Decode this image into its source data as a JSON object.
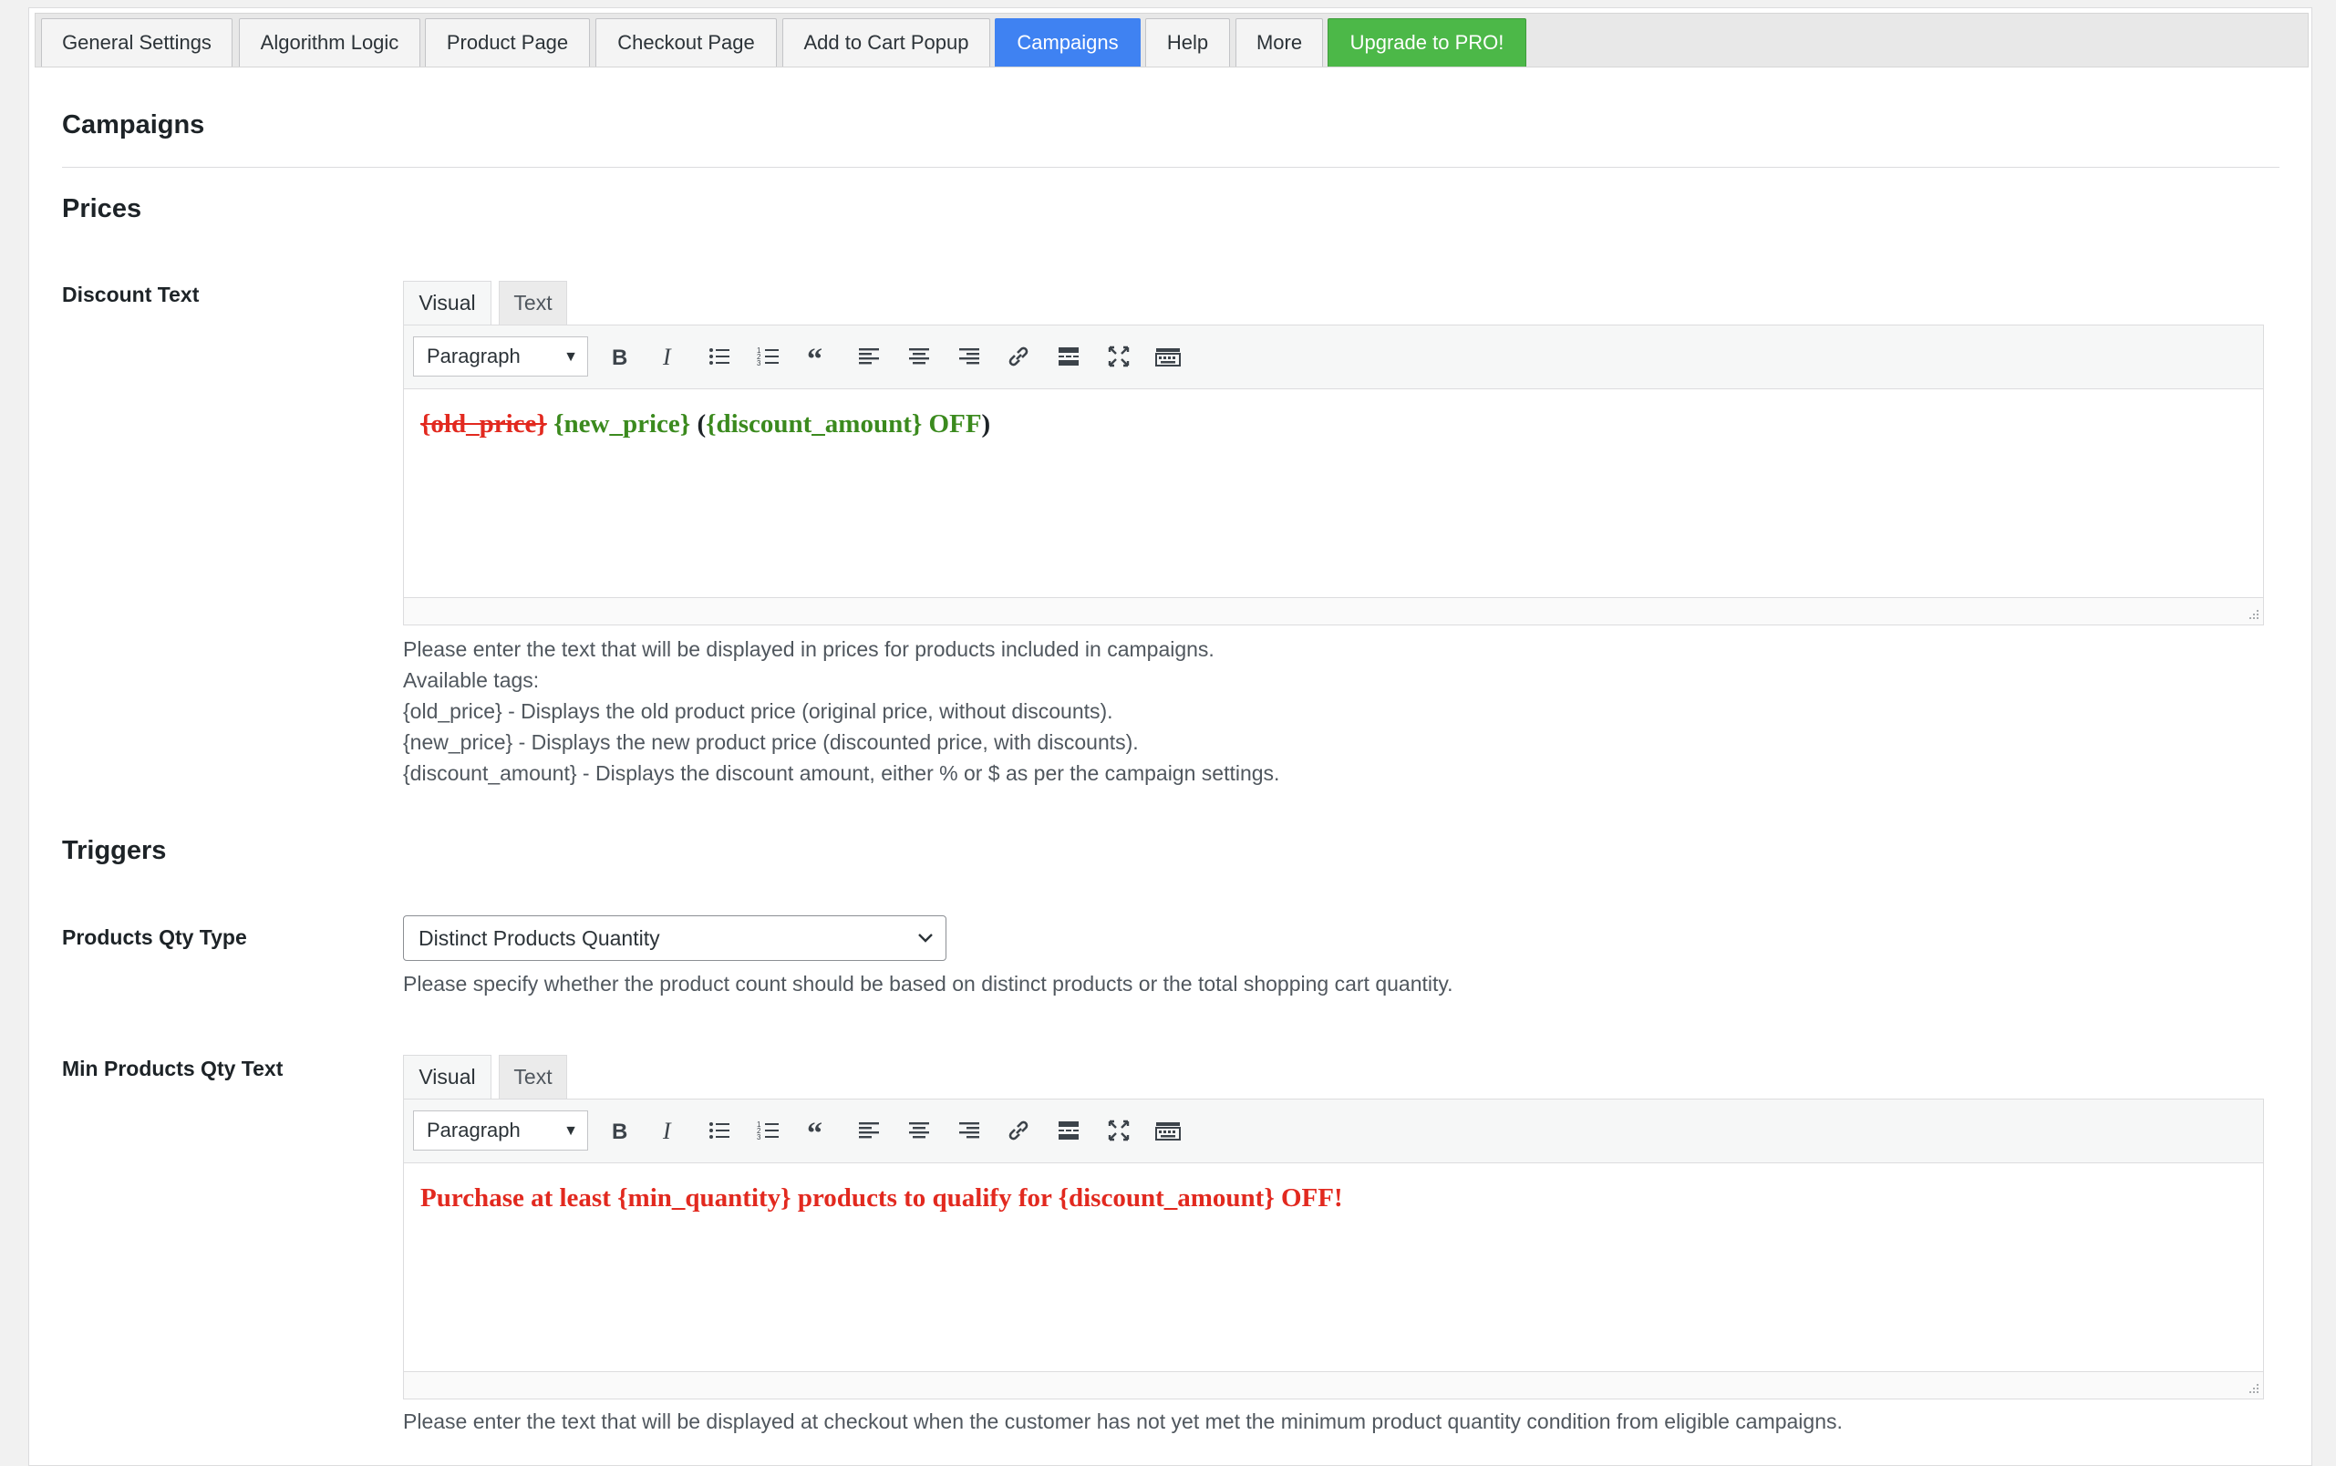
{
  "tabs": [
    {
      "label": "General Settings"
    },
    {
      "label": "Algorithm Logic"
    },
    {
      "label": "Product Page"
    },
    {
      "label": "Checkout Page"
    },
    {
      "label": "Add to Cart Popup"
    },
    {
      "label": "Campaigns",
      "active": true
    },
    {
      "label": "Help"
    },
    {
      "label": "More"
    },
    {
      "label": "Upgrade to PRO!"
    }
  ],
  "page": {
    "title": "Campaigns",
    "prices_heading": "Prices",
    "triggers_heading": "Triggers"
  },
  "editor_common": {
    "visual_tab": "Visual",
    "text_tab": "Text",
    "format_value": "Paragraph",
    "toolbar_icons": [
      "bold-icon",
      "italic-icon",
      "bullet-list-icon",
      "numbered-list-icon",
      "blockquote-icon",
      "align-left-icon",
      "align-center-icon",
      "align-right-icon",
      "link-icon",
      "read-more-icon",
      "fullscreen-icon",
      "toolbar-toggle-icon"
    ]
  },
  "discount": {
    "label": "Discount Text",
    "old_price": "{old_price}",
    "new_price": "{new_price}",
    "open_paren": "(",
    "amount": "{discount_amount} OFF",
    "close_paren": ")",
    "help": [
      "Please enter the text that will be displayed in prices for products included in campaigns.",
      "Available tags:",
      "{old_price} - Displays the old product price (original price, without discounts).",
      "{new_price} - Displays the new product price (discounted price, with discounts).",
      "{discount_amount} - Displays the discount amount, either % or $ as per the campaign settings."
    ]
  },
  "qty_type": {
    "label": "Products Qty Type",
    "value": "Distinct Products Quantity",
    "help": "Please specify whether the product count should be based on distinct products or the total shopping cart quantity."
  },
  "min_qty": {
    "label": "Min Products Qty Text",
    "content": "Purchase at least {min_quantity} products to qualify for {discount_amount} OFF!",
    "help": "Please enter the text that will be displayed at checkout when the customer has not yet met the minimum product quantity condition from eligible campaigns."
  },
  "colors": {
    "accent": "#3f82f2",
    "pro": "#4cb848",
    "red": "#e2291f",
    "green": "#3b8a1e"
  }
}
